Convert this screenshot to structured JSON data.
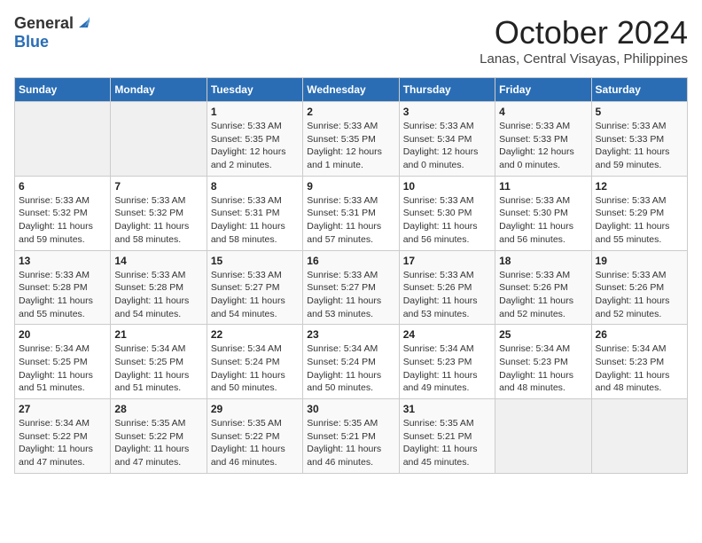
{
  "header": {
    "logo_general": "General",
    "logo_blue": "Blue",
    "month": "October 2024",
    "location": "Lanas, Central Visayas, Philippines"
  },
  "calendar": {
    "days_of_week": [
      "Sunday",
      "Monday",
      "Tuesday",
      "Wednesday",
      "Thursday",
      "Friday",
      "Saturday"
    ],
    "weeks": [
      [
        {
          "day": "",
          "sunrise": "",
          "sunset": "",
          "daylight": "",
          "empty": true
        },
        {
          "day": "",
          "sunrise": "",
          "sunset": "",
          "daylight": "",
          "empty": true
        },
        {
          "day": "1",
          "sunrise": "Sunrise: 5:33 AM",
          "sunset": "Sunset: 5:35 PM",
          "daylight": "Daylight: 12 hours and 2 minutes."
        },
        {
          "day": "2",
          "sunrise": "Sunrise: 5:33 AM",
          "sunset": "Sunset: 5:35 PM",
          "daylight": "Daylight: 12 hours and 1 minute."
        },
        {
          "day": "3",
          "sunrise": "Sunrise: 5:33 AM",
          "sunset": "Sunset: 5:34 PM",
          "daylight": "Daylight: 12 hours and 0 minutes."
        },
        {
          "day": "4",
          "sunrise": "Sunrise: 5:33 AM",
          "sunset": "Sunset: 5:33 PM",
          "daylight": "Daylight: 12 hours and 0 minutes."
        },
        {
          "day": "5",
          "sunrise": "Sunrise: 5:33 AM",
          "sunset": "Sunset: 5:33 PM",
          "daylight": "Daylight: 11 hours and 59 minutes."
        }
      ],
      [
        {
          "day": "6",
          "sunrise": "Sunrise: 5:33 AM",
          "sunset": "Sunset: 5:32 PM",
          "daylight": "Daylight: 11 hours and 59 minutes."
        },
        {
          "day": "7",
          "sunrise": "Sunrise: 5:33 AM",
          "sunset": "Sunset: 5:32 PM",
          "daylight": "Daylight: 11 hours and 58 minutes."
        },
        {
          "day": "8",
          "sunrise": "Sunrise: 5:33 AM",
          "sunset": "Sunset: 5:31 PM",
          "daylight": "Daylight: 11 hours and 58 minutes."
        },
        {
          "day": "9",
          "sunrise": "Sunrise: 5:33 AM",
          "sunset": "Sunset: 5:31 PM",
          "daylight": "Daylight: 11 hours and 57 minutes."
        },
        {
          "day": "10",
          "sunrise": "Sunrise: 5:33 AM",
          "sunset": "Sunset: 5:30 PM",
          "daylight": "Daylight: 11 hours and 56 minutes."
        },
        {
          "day": "11",
          "sunrise": "Sunrise: 5:33 AM",
          "sunset": "Sunset: 5:30 PM",
          "daylight": "Daylight: 11 hours and 56 minutes."
        },
        {
          "day": "12",
          "sunrise": "Sunrise: 5:33 AM",
          "sunset": "Sunset: 5:29 PM",
          "daylight": "Daylight: 11 hours and 55 minutes."
        }
      ],
      [
        {
          "day": "13",
          "sunrise": "Sunrise: 5:33 AM",
          "sunset": "Sunset: 5:28 PM",
          "daylight": "Daylight: 11 hours and 55 minutes."
        },
        {
          "day": "14",
          "sunrise": "Sunrise: 5:33 AM",
          "sunset": "Sunset: 5:28 PM",
          "daylight": "Daylight: 11 hours and 54 minutes."
        },
        {
          "day": "15",
          "sunrise": "Sunrise: 5:33 AM",
          "sunset": "Sunset: 5:27 PM",
          "daylight": "Daylight: 11 hours and 54 minutes."
        },
        {
          "day": "16",
          "sunrise": "Sunrise: 5:33 AM",
          "sunset": "Sunset: 5:27 PM",
          "daylight": "Daylight: 11 hours and 53 minutes."
        },
        {
          "day": "17",
          "sunrise": "Sunrise: 5:33 AM",
          "sunset": "Sunset: 5:26 PM",
          "daylight": "Daylight: 11 hours and 53 minutes."
        },
        {
          "day": "18",
          "sunrise": "Sunrise: 5:33 AM",
          "sunset": "Sunset: 5:26 PM",
          "daylight": "Daylight: 11 hours and 52 minutes."
        },
        {
          "day": "19",
          "sunrise": "Sunrise: 5:33 AM",
          "sunset": "Sunset: 5:26 PM",
          "daylight": "Daylight: 11 hours and 52 minutes."
        }
      ],
      [
        {
          "day": "20",
          "sunrise": "Sunrise: 5:34 AM",
          "sunset": "Sunset: 5:25 PM",
          "daylight": "Daylight: 11 hours and 51 minutes."
        },
        {
          "day": "21",
          "sunrise": "Sunrise: 5:34 AM",
          "sunset": "Sunset: 5:25 PM",
          "daylight": "Daylight: 11 hours and 51 minutes."
        },
        {
          "day": "22",
          "sunrise": "Sunrise: 5:34 AM",
          "sunset": "Sunset: 5:24 PM",
          "daylight": "Daylight: 11 hours and 50 minutes."
        },
        {
          "day": "23",
          "sunrise": "Sunrise: 5:34 AM",
          "sunset": "Sunset: 5:24 PM",
          "daylight": "Daylight: 11 hours and 50 minutes."
        },
        {
          "day": "24",
          "sunrise": "Sunrise: 5:34 AM",
          "sunset": "Sunset: 5:23 PM",
          "daylight": "Daylight: 11 hours and 49 minutes."
        },
        {
          "day": "25",
          "sunrise": "Sunrise: 5:34 AM",
          "sunset": "Sunset: 5:23 PM",
          "daylight": "Daylight: 11 hours and 48 minutes."
        },
        {
          "day": "26",
          "sunrise": "Sunrise: 5:34 AM",
          "sunset": "Sunset: 5:23 PM",
          "daylight": "Daylight: 11 hours and 48 minutes."
        }
      ],
      [
        {
          "day": "27",
          "sunrise": "Sunrise: 5:34 AM",
          "sunset": "Sunset: 5:22 PM",
          "daylight": "Daylight: 11 hours and 47 minutes."
        },
        {
          "day": "28",
          "sunrise": "Sunrise: 5:35 AM",
          "sunset": "Sunset: 5:22 PM",
          "daylight": "Daylight: 11 hours and 47 minutes."
        },
        {
          "day": "29",
          "sunrise": "Sunrise: 5:35 AM",
          "sunset": "Sunset: 5:22 PM",
          "daylight": "Daylight: 11 hours and 46 minutes."
        },
        {
          "day": "30",
          "sunrise": "Sunrise: 5:35 AM",
          "sunset": "Sunset: 5:21 PM",
          "daylight": "Daylight: 11 hours and 46 minutes."
        },
        {
          "day": "31",
          "sunrise": "Sunrise: 5:35 AM",
          "sunset": "Sunset: 5:21 PM",
          "daylight": "Daylight: 11 hours and 45 minutes."
        },
        {
          "day": "",
          "sunrise": "",
          "sunset": "",
          "daylight": "",
          "empty": true
        },
        {
          "day": "",
          "sunrise": "",
          "sunset": "",
          "daylight": "",
          "empty": true
        }
      ]
    ]
  }
}
